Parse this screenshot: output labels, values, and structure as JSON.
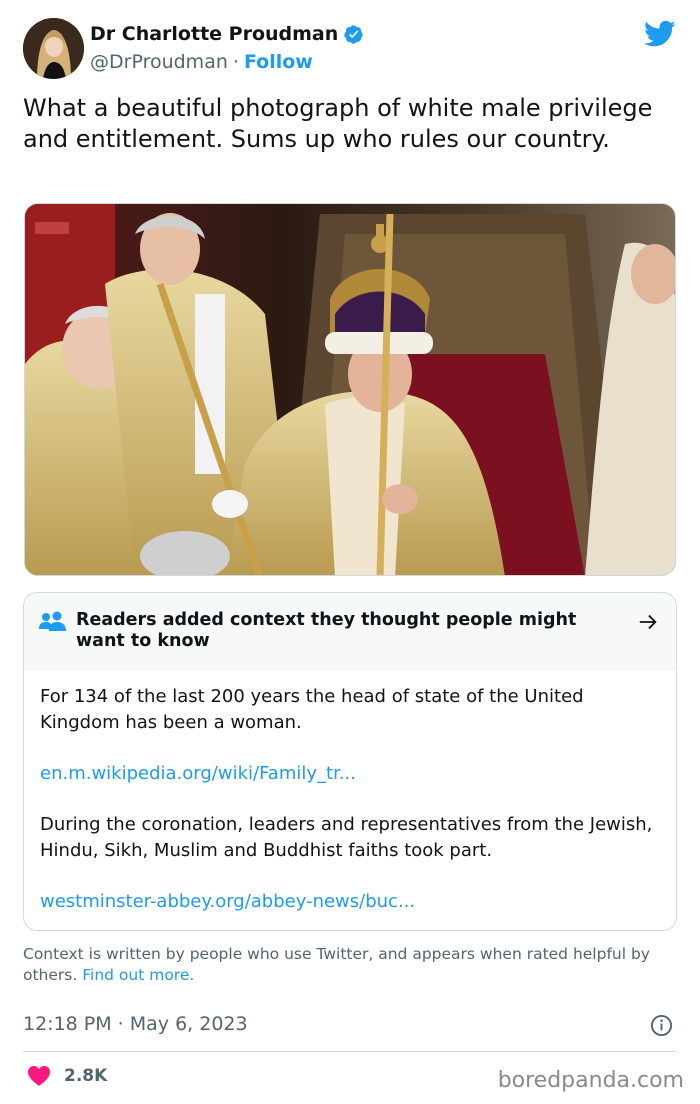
{
  "author": {
    "name": "Dr Charlotte Proudman",
    "handle": "@DrProudman",
    "separator": "·",
    "follow_label": "Follow"
  },
  "tweet": {
    "text": "What a beautiful photograph of white male privilege and entitlement. Sums up who rules our country."
  },
  "photo": {
    "icon": "coronation-photo"
  },
  "community_note": {
    "title": "Readers added context they thought people might want to know",
    "items": [
      {
        "text": "For 134 of the last 200 years the head of state of the United Kingdom has been a woman.",
        "link": "en.m.wikipedia.org/wiki/Family_tr..."
      },
      {
        "text": "During the coronation, leaders and representatives from the Jewish, Hindu, Sikh, Muslim and Buddhist faiths took part.",
        "link": "westminster-abbey.org/abbey-news/buc..."
      }
    ]
  },
  "context_footer": {
    "text": "Context is written by people who use Twitter, and appears when rated helpful by others.",
    "find_out_more": "Find out more."
  },
  "meta": {
    "timestamp": "12:18 PM · May 6, 2023",
    "likes": "2.8K"
  },
  "watermark": "boredpanda.com",
  "colors": {
    "accent": "#1d9bf0",
    "heart": "#f91880",
    "muted": "#536471"
  }
}
